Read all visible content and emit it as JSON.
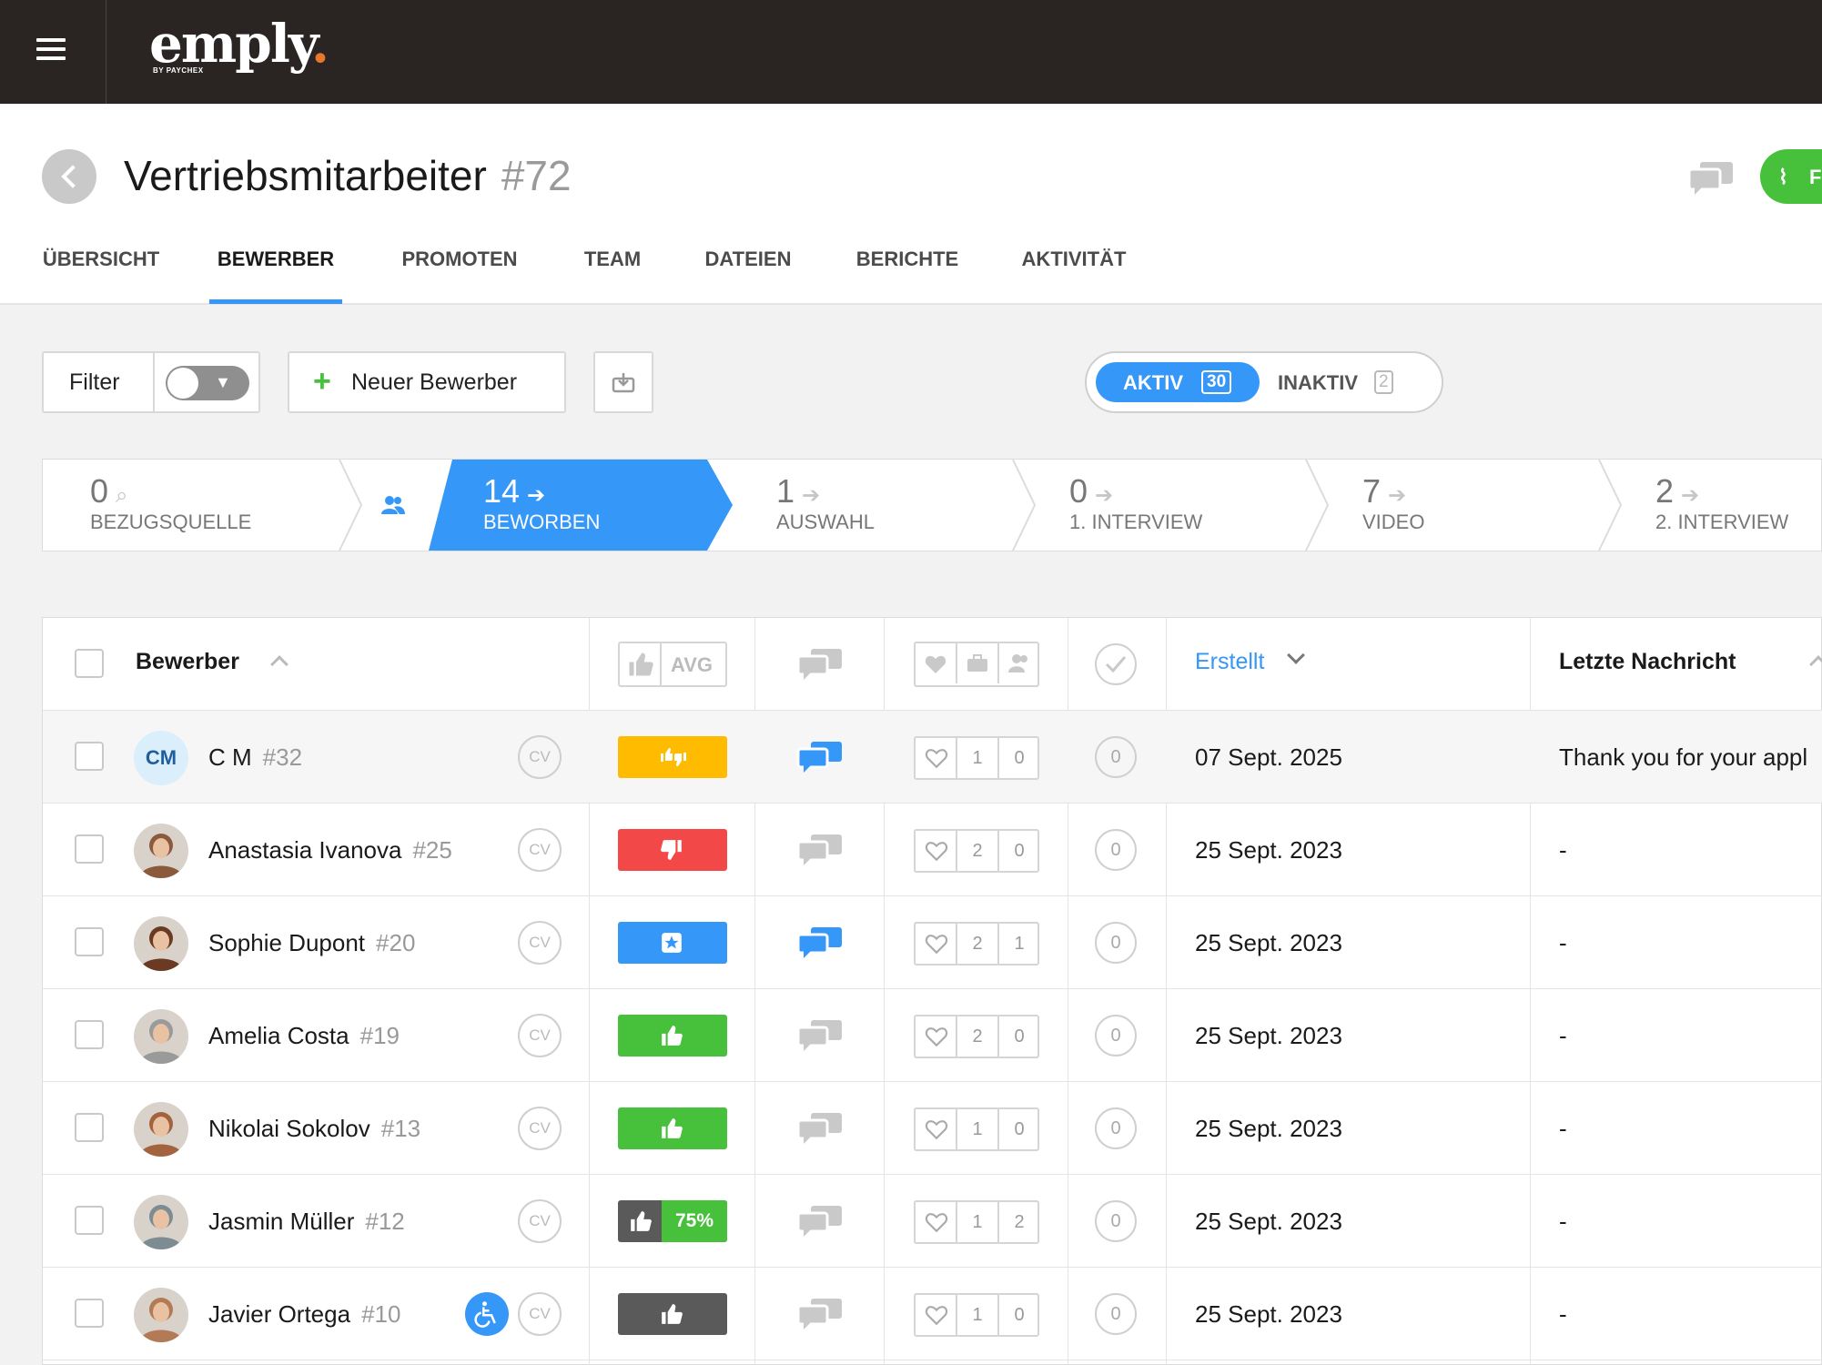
{
  "app": {
    "logo_text": "emply",
    "logo_sub": "BY PAYCHEX"
  },
  "header": {
    "title": "Vertriebsmitarbeiter",
    "job_number": "#72",
    "feed_label": "F"
  },
  "tabs": [
    {
      "label": "ÜBERSICHT",
      "active": false
    },
    {
      "label": "BEWERBER",
      "active": true
    },
    {
      "label": "PROMOTEN",
      "active": false
    },
    {
      "label": "TEAM",
      "active": false
    },
    {
      "label": "DATEIEN",
      "active": false
    },
    {
      "label": "BERICHTE",
      "active": false
    },
    {
      "label": "AKTIVITÄT",
      "active": false
    }
  ],
  "toolbar": {
    "filter_label": "Filter",
    "new_label": "Neuer Bewerber",
    "status": {
      "active_label": "AKTIV",
      "active_count": "30",
      "inactive_label": "INAKTIV",
      "inactive_count": "2"
    }
  },
  "pipeline": [
    {
      "count": "0",
      "name": "BEZUGSQUELLE",
      "icon": "search-icon"
    },
    {
      "count": "14",
      "name": "BEWORBEN",
      "icon": "arrow-right-icon",
      "active": true
    },
    {
      "count": "1",
      "name": "AUSWAHL",
      "icon": "arrow-right-icon"
    },
    {
      "count": "0",
      "name": "1. INTERVIEW",
      "icon": "arrow-right-icon"
    },
    {
      "count": "7",
      "name": "VIDEO",
      "icon": "arrow-right-icon"
    },
    {
      "count": "2",
      "name": "2. INTERVIEW",
      "icon": "arrow-right-icon"
    }
  ],
  "table": {
    "headers": {
      "candidate": "Bewerber",
      "avg": "AVG",
      "created": "Erstellt",
      "last_message": "Letzte Nachricht"
    },
    "rows": [
      {
        "initials": "CM",
        "name": "C M",
        "num": "#32",
        "rating": "mixed",
        "rating_color": "#ffbb00",
        "msg_active": true,
        "likes": "1",
        "extra": "0",
        "zero": "0",
        "created": "07 Sept. 2025",
        "last_message": "Thank you for your appl",
        "highlight": true
      },
      {
        "name": "Anastasia Ivanova",
        "num": "#25",
        "rating": "thumbs-down",
        "rating_color": "#f24848",
        "msg_active": false,
        "likes": "2",
        "extra": "0",
        "zero": "0",
        "created": "25 Sept. 2023",
        "last_message": "-",
        "avatar_color": "#8b5a3c"
      },
      {
        "name": "Sophie Dupont",
        "num": "#20",
        "rating": "star",
        "rating_color": "#3597f7",
        "msg_active": true,
        "likes": "2",
        "extra": "1",
        "zero": "0",
        "created": "25 Sept. 2023",
        "last_message": "-",
        "avatar_color": "#6b3a22"
      },
      {
        "name": "Amelia Costa",
        "num": "#19",
        "rating": "thumbs-up",
        "rating_color": "#47c13c",
        "msg_active": false,
        "likes": "2",
        "extra": "0",
        "zero": "0",
        "created": "25 Sept. 2023",
        "last_message": "-",
        "avatar_color": "#9a9a9a"
      },
      {
        "name": "Nikolai Sokolov",
        "num": "#13",
        "rating": "thumbs-up",
        "rating_color": "#47c13c",
        "msg_active": false,
        "likes": "1",
        "extra": "0",
        "zero": "0",
        "created": "25 Sept. 2023",
        "last_message": "-",
        "avatar_color": "#a4633f"
      },
      {
        "name": "Jasmin Müller",
        "num": "#12",
        "rating": "percent",
        "rating_color": "#5a5a5a",
        "rating_pct": "75%",
        "msg_active": false,
        "likes": "1",
        "extra": "2",
        "zero": "0",
        "created": "25 Sept. 2023",
        "last_message": "-",
        "avatar_color": "#7d8b93"
      },
      {
        "name": "Javier Ortega",
        "num": "#10",
        "rating": "thumbs-up",
        "rating_color": "#5a5a5a",
        "msg_active": false,
        "likes": "1",
        "extra": "0",
        "zero": "0",
        "created": "25 Sept. 2023",
        "last_message": "-",
        "avatar_color": "#b27a55",
        "accessibility": true
      }
    ]
  },
  "colors": {
    "accent": "#3597f7",
    "success": "#47c13c",
    "danger": "#f24848",
    "warning": "#ffbb00",
    "topbar": "#2a2523"
  }
}
